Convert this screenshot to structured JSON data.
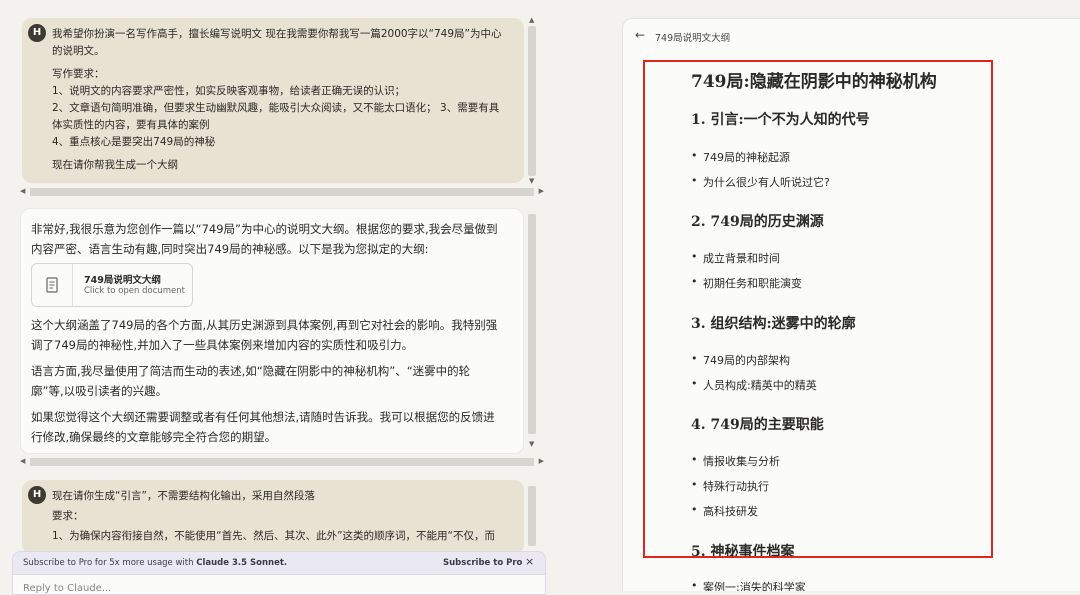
{
  "conversation": {
    "user1": {
      "avatar": "H",
      "lines": [
        "我希望你扮演一名写作高手，擅长编写说明文 现在我需要你帮我写一篇2000字以“749局”为中心",
        "的说明文。",
        "写作要求：",
        "1、说明文的内容要求严密性，如实反映客观事物，给读者正确无误的认识；",
        "2、文章语句简明准确，但要求生动幽默风趣，能吸引大众阅读，又不能太口语化； 3、需要有具",
        "体实质性的内容，要有具体的案例",
        "4、重点核心是要突出749局的神秘",
        "现在请你帮我生成一个大纲"
      ]
    },
    "ai1": {
      "para1_l1": "非常好,我很乐意为您创作一篇以“749局”为中心的说明文大纲。根据您的要求,我会尽量做到",
      "para1_l2": "内容严密、语言生动有趣,同时突出749局的神秘感。以下是我为您拟定的大纲:",
      "card_title": "749局说明文大纲",
      "card_sub": "Click to open document",
      "para2_l1": "这个大纲涵盖了749局的各个方面,从其历史渊源到具体案例,再到它对社会的影响。我特别强",
      "para2_l2": "调了749局的神秘性,并加入了一些具体案例来增加内容的实质性和吸引力。",
      "para3_l1": "语言方面,我尽量使用了简洁而生动的表述,如“隐藏在阴影中的神秘机构”、“迷雾中的轮",
      "para3_l2": "廓”等,以吸引读者的兴趣。",
      "para4_l1": "如果您觉得这个大纲还需要调整或者有任何其他想法,请随时告诉我。我可以根据您的反馈进",
      "para4_l2": "行修改,确保最终的文章能够完全符合您的期望。"
    },
    "user2": {
      "avatar": "H",
      "lines": [
        "现在请你生成“引言”，不需要结构化输出，采用自然段落",
        "要求：",
        "1、为确保内容衔接自然，不能使用“首先、然后、其次、此外”这类的顺序词，不能用“不仅，而"
      ]
    }
  },
  "banner": {
    "text_prefix": "Subscribe to Pro for 5x more usage with",
    "text_bold": "Claude 3.5 Sonnet.",
    "link": "Subscribe to Pro",
    "close": "×"
  },
  "input": {
    "placeholder": "Reply to Claude..."
  },
  "document": {
    "header_title": "749局说明文大纲",
    "title": "749局:隐藏在阴影中的神秘机构",
    "sections": [
      {
        "heading": "1. 引言:一个不为人知的代号",
        "items": [
          "749局的神秘起源",
          "为什么很少有人听说过它?"
        ]
      },
      {
        "heading": "2. 749局的历史渊源",
        "items": [
          "成立背景和时间",
          "初期任务和职能演变"
        ]
      },
      {
        "heading": "3. 组织结构:迷雾中的轮廓",
        "items": [
          "749局的内部架构",
          "人员构成:精英中的精英"
        ]
      },
      {
        "heading": "4. 749局的主要职能",
        "items": [
          "情报收集与分析",
          "特殊行动执行",
          "高科技研发"
        ]
      },
      {
        "heading": "5. 神秘事件档案",
        "items": [
          "案例一:消失的科学家"
        ]
      }
    ]
  },
  "colors": {
    "highlight_frame": "#e0261b",
    "user_bubble": "#e8e2d3"
  }
}
